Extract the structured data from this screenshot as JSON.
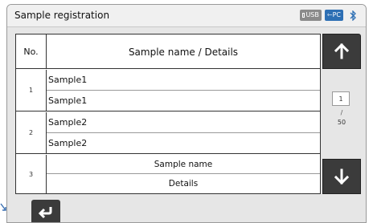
{
  "header": {
    "title": "Sample registration",
    "status": {
      "usb_label": "USB",
      "pc_label": "PC",
      "bluetooth_icon": "bluetooth-icon"
    }
  },
  "table": {
    "col_no": "No.",
    "col_name": "Sample name / Details",
    "rows": [
      {
        "no": "1",
        "name": "Sample1",
        "details": "Sample1"
      },
      {
        "no": "2",
        "name": "Sample2",
        "details": "Sample2"
      },
      {
        "no": "3",
        "name": "Sample name",
        "details": "Details"
      }
    ]
  },
  "pager": {
    "current": "1",
    "slash": "/",
    "total": "50"
  },
  "icons": {
    "up": "arrow-up-icon",
    "down": "arrow-down-icon",
    "back": "return-icon"
  },
  "colors": {
    "button_dark": "#3b3b3b",
    "pc_badge": "#2d6fb4",
    "panel_bg": "#e6e6e6"
  }
}
